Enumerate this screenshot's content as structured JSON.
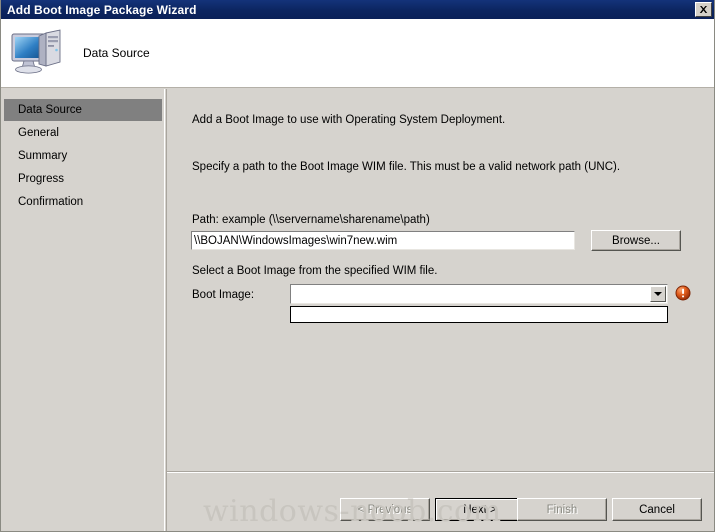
{
  "window": {
    "title": "Add Boot Image Package Wizard",
    "close_icon": "close-icon"
  },
  "header": {
    "icon": "computer-icon",
    "title": "Data Source"
  },
  "sidebar": {
    "items": [
      {
        "label": "Data Source",
        "selected": true
      },
      {
        "label": "General",
        "selected": false
      },
      {
        "label": "Summary",
        "selected": false
      },
      {
        "label": "Progress",
        "selected": false
      },
      {
        "label": "Confirmation",
        "selected": false
      }
    ]
  },
  "content": {
    "intro_line_1": "Add a Boot Image to use with Operating System Deployment.",
    "intro_line_2": "Specify a path to the Boot Image WIM file. This must be a valid network path (UNC).",
    "path_label": "Path: example (\\\\servername\\sharename\\path)",
    "path_value": "\\\\BOJAN\\WindowsImages\\win7new.wim",
    "path_placeholder": "",
    "browse_label": "Browse...",
    "select_label": "Select a Boot Image from the specified WIM file.",
    "bootimage_label": "Boot Image:",
    "bootimage_value": "",
    "bootimage_options": [],
    "dropdown_arrow_icon": "chevron-down-icon",
    "error_icon": "error-icon"
  },
  "footer": {
    "previous_label": "< Previous",
    "next_label": "Next >",
    "finish_label": "Finish",
    "cancel_label": "Cancel"
  },
  "watermark": {
    "text": "windows-noob.com"
  },
  "colors": {
    "dialog_background": "#d6d3ce",
    "titlebar_background": "#0c2560",
    "titlebar_text": "#ffffff",
    "selection_background": "#808080",
    "error_accent": "#d84b16",
    "watermark": "#c8c5bf"
  }
}
